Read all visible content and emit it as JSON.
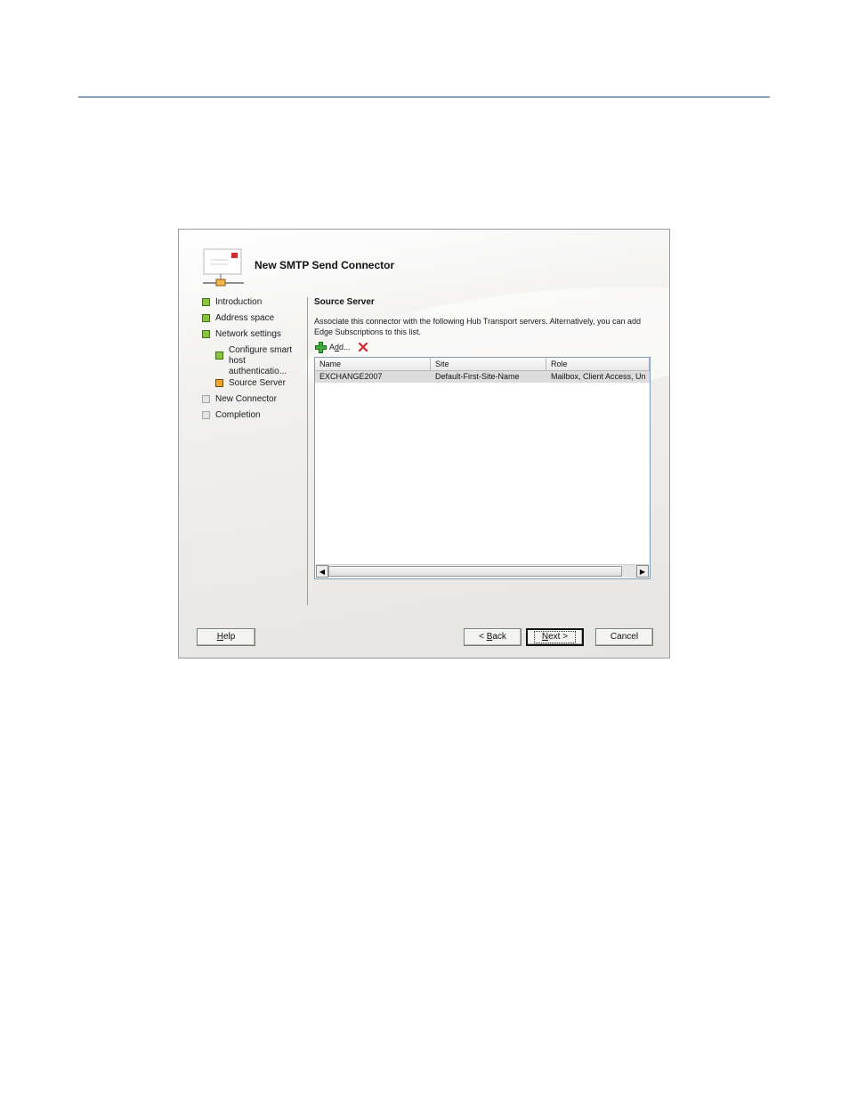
{
  "wizard": {
    "title": "New SMTP Send Connector",
    "steps": [
      {
        "label": "Introduction",
        "status": "completed"
      },
      {
        "label": "Address space",
        "status": "completed"
      },
      {
        "label": "Network settings",
        "status": "completed"
      },
      {
        "label_line1": "Configure smart",
        "label_line2": "host authenticatio...",
        "status": "completed"
      },
      {
        "label": "Source Server",
        "status": "current"
      },
      {
        "label": "New Connector",
        "status": "pending"
      },
      {
        "label": "Completion",
        "status": "pending"
      }
    ]
  },
  "page": {
    "title": "Source Server",
    "description": "Associate this connector with the following Hub Transport servers. Alternatively, you can add Edge Subscriptions to this list."
  },
  "toolbar": {
    "add_label_pre": "A",
    "add_label_mn": "d",
    "add_label_post": "d...",
    "add_icon": "plus-icon",
    "remove_icon": "red-x-icon"
  },
  "grid": {
    "columns": [
      "Name",
      "Site",
      "Role"
    ],
    "rows": [
      [
        "EXCHANGE2007",
        "Default-First-Site-Name",
        "Mailbox, Client Access, Un"
      ]
    ]
  },
  "buttons": {
    "help_mn": "H",
    "help_rest": "elp",
    "back_pre": "< ",
    "back_mn": "B",
    "back_rest": "ack",
    "next_mn": "N",
    "next_rest": "ext >",
    "cancel": "Cancel"
  },
  "colors": {
    "completed_bullet": "#8ac43f",
    "current_bullet": "#f2a627",
    "pending_bullet": "#e4e4e4",
    "page_rule": "#8ea2bf"
  }
}
